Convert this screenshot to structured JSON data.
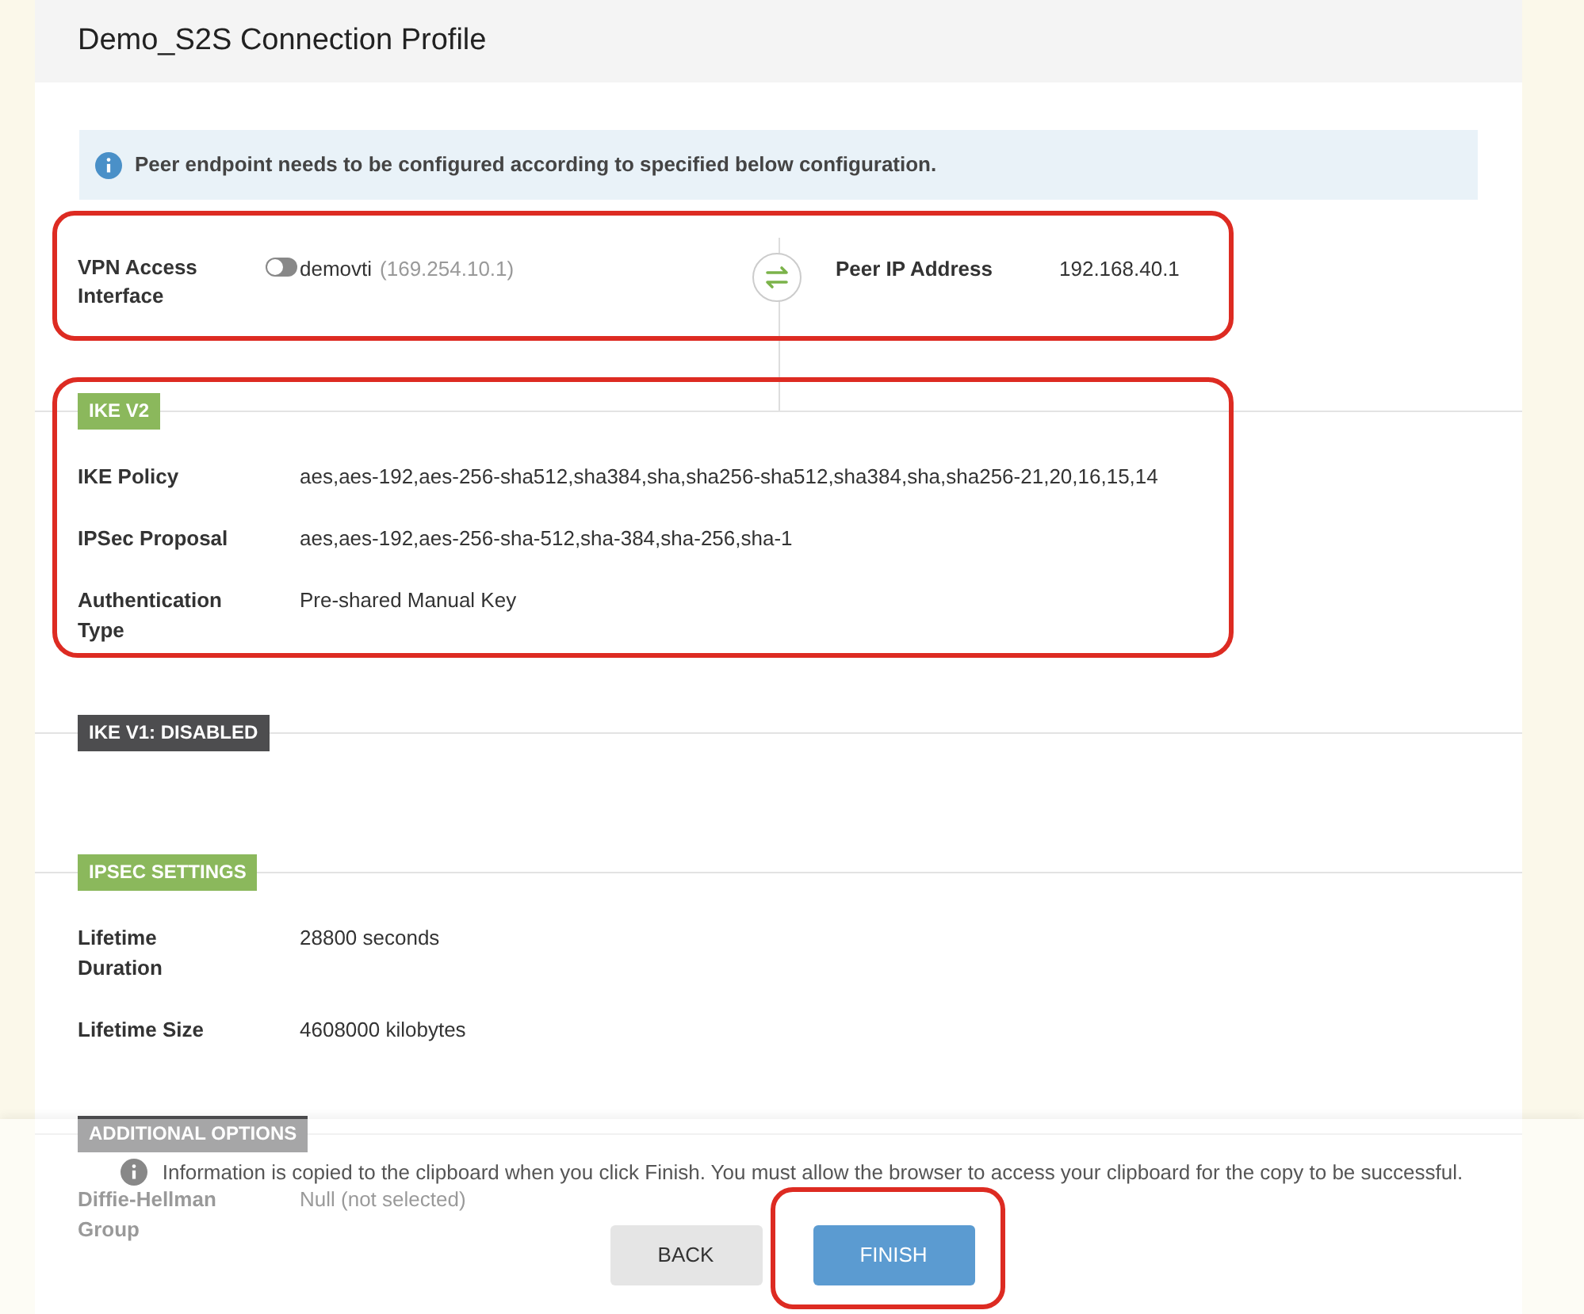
{
  "title": "Demo_S2S Connection Profile",
  "info_banner": "Peer endpoint needs to be configured according to specified below configuration.",
  "vpn_interface": {
    "label": "VPN Access Interface",
    "toggle_on": false,
    "name": "demovti",
    "ip": "(169.254.10.1)"
  },
  "peer": {
    "label": "Peer IP Address",
    "value": "192.168.40.1"
  },
  "sections": [
    {
      "badge": "IKE V2",
      "kind": "enabled",
      "rows": [
        {
          "label": "IKE Policy",
          "value": "aes,aes-192,aes-256-sha512,sha384,sha,sha256-sha512,sha384,sha,sha256-21,20,16,15,14"
        },
        {
          "label": "IPSec Proposal",
          "value": "aes,aes-192,aes-256-sha-512,sha-384,sha-256,sha-1"
        },
        {
          "label": "Authentication Type",
          "value": "Pre-shared Manual Key"
        }
      ]
    },
    {
      "badge": "IKE V1: DISABLED",
      "kind": "disabled"
    },
    {
      "badge": "IPSEC SETTINGS",
      "kind": "enabled",
      "rows": [
        {
          "label": "Lifetime Duration",
          "value": "28800 seconds"
        },
        {
          "label": "Lifetime Size",
          "value": "4608000 kilobytes"
        }
      ]
    },
    {
      "badge": "ADDITIONAL OPTIONS",
      "kind": "disabled",
      "rows": [
        {
          "label": "Diffie-Hellman Group",
          "value": "Null (not selected)"
        }
      ]
    }
  ],
  "footer_note": "Information is copied to the clipboard when you click Finish. You must allow the browser to access your clipboard for the copy to be successful.",
  "buttons": [
    {
      "label": "BACK",
      "kind": "secondary"
    },
    {
      "label": "FINISH",
      "kind": "primary"
    }
  ]
}
